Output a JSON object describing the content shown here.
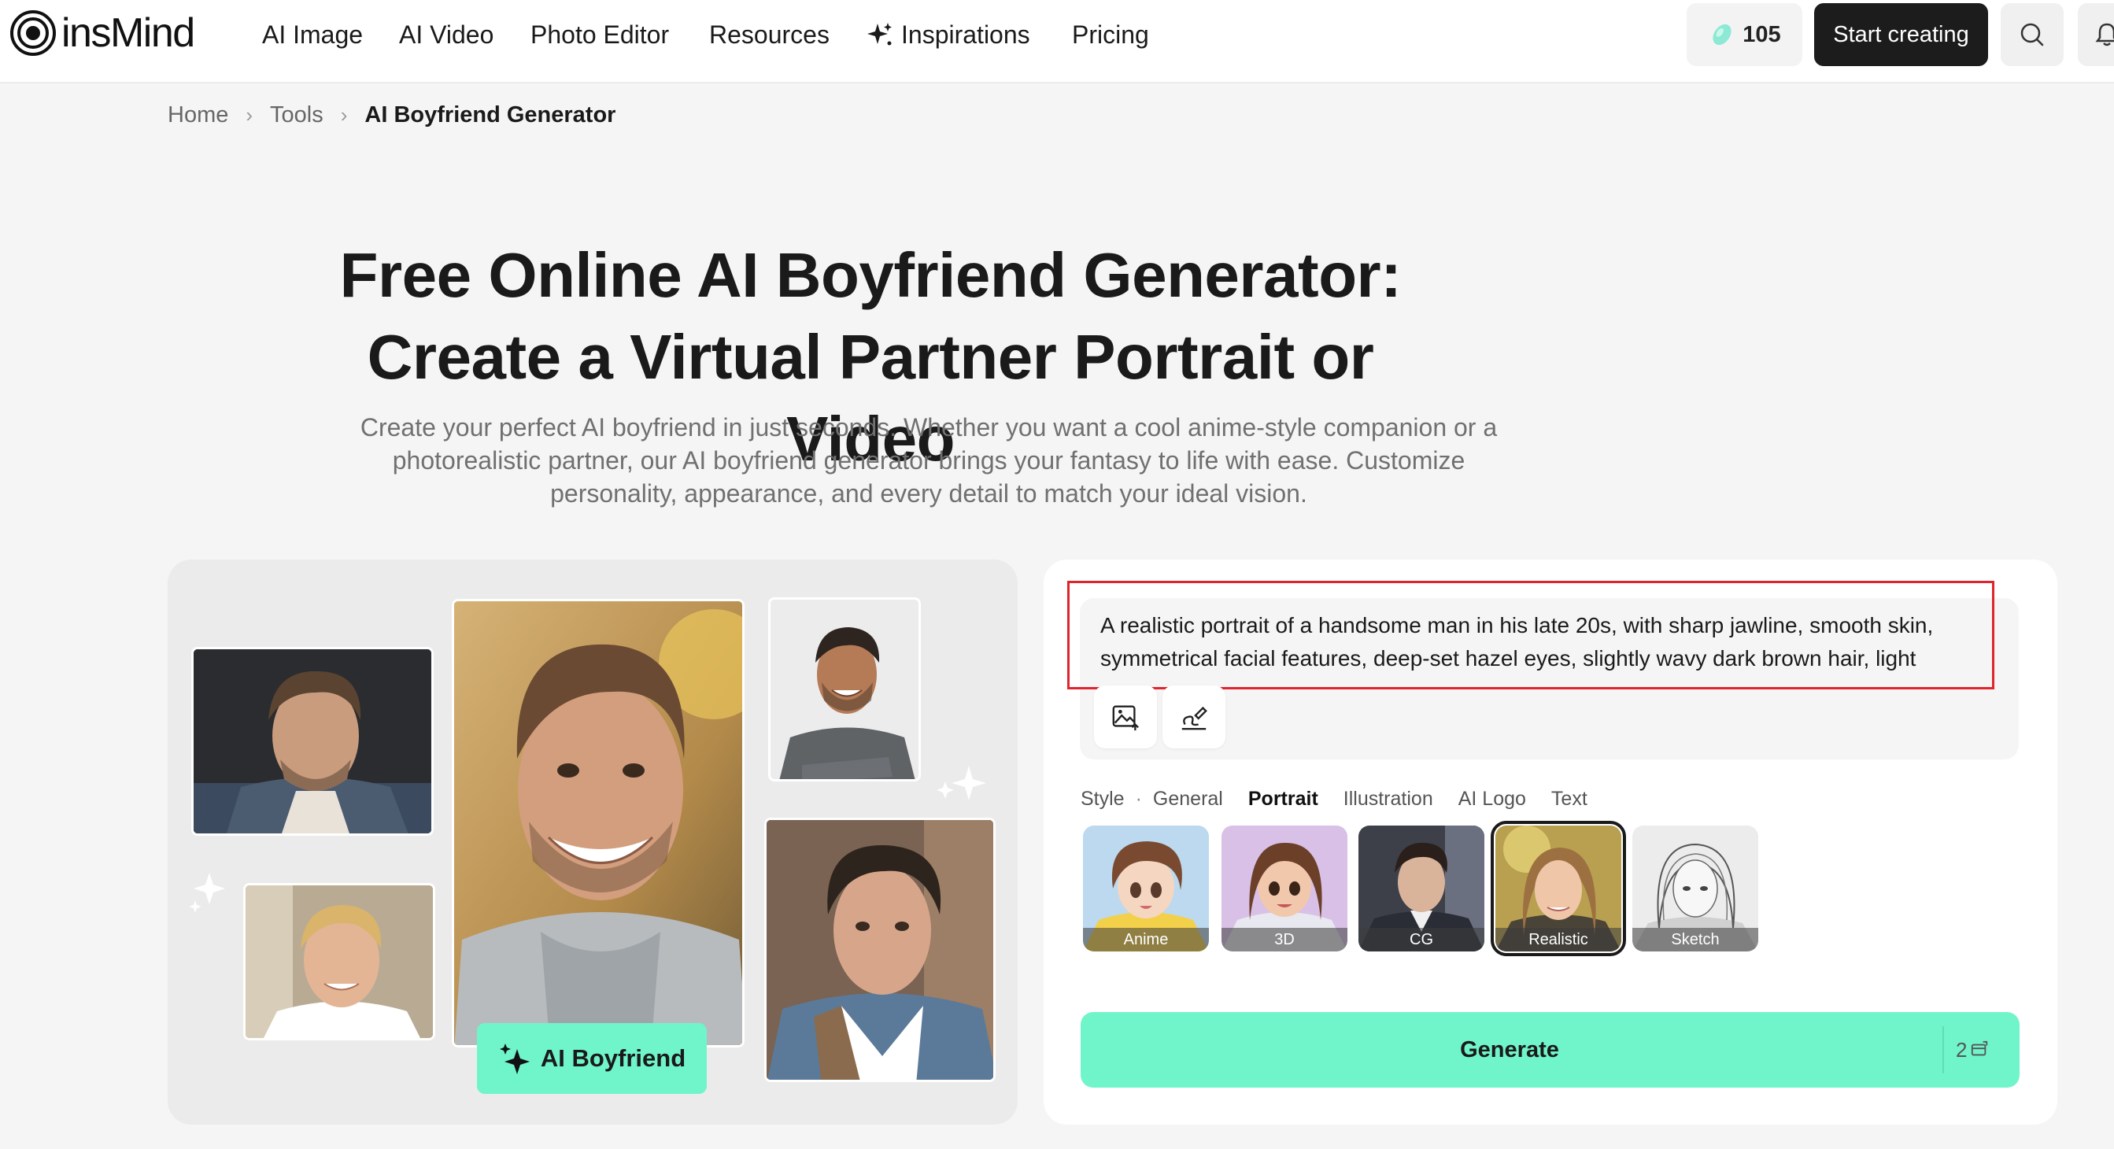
{
  "nav": {
    "logo_text": "insMind",
    "items": [
      "AI Image",
      "AI Video",
      "Photo Editor",
      "Resources",
      "Inspirations",
      "Pricing"
    ],
    "credits": "105",
    "start_label": "Start creating"
  },
  "breadcrumb": {
    "home": "Home",
    "tools": "Tools",
    "current": "AI Boyfriend Generator"
  },
  "hero": {
    "title": "Free Online AI Boyfriend Generator: Create a Virtual Partner Portrait or Video",
    "subtitle": "Create your perfect AI boyfriend in just seconds. Whether you want a cool anime-style companion or a photorealistic partner, our AI boyfriend generator brings your fantasy to life with ease. Customize personality, appearance, and every detail to match your ideal vision."
  },
  "showcase": {
    "badge_label": "AI Boyfriend"
  },
  "panel": {
    "prompt_text": "A realistic portrait of a handsome man in his late 20s, with sharp jawline, smooth skin, symmetrical facial features, deep-set hazel eyes, slightly wavy dark brown hair, light",
    "style_label": "Style",
    "tabs": [
      "General",
      "Portrait",
      "Illustration",
      "AI Logo",
      "Text"
    ],
    "active_tab": "Portrait",
    "styles": [
      "Anime",
      "3D",
      "CG",
      "Realistic",
      "Sketch"
    ],
    "selected_style": "Realistic",
    "generate_label": "Generate",
    "generate_cost": "2"
  },
  "colors": {
    "accent": "#6ff5c9",
    "highlight_frame": "#e0242c",
    "dark_button": "#1c1c1c"
  }
}
